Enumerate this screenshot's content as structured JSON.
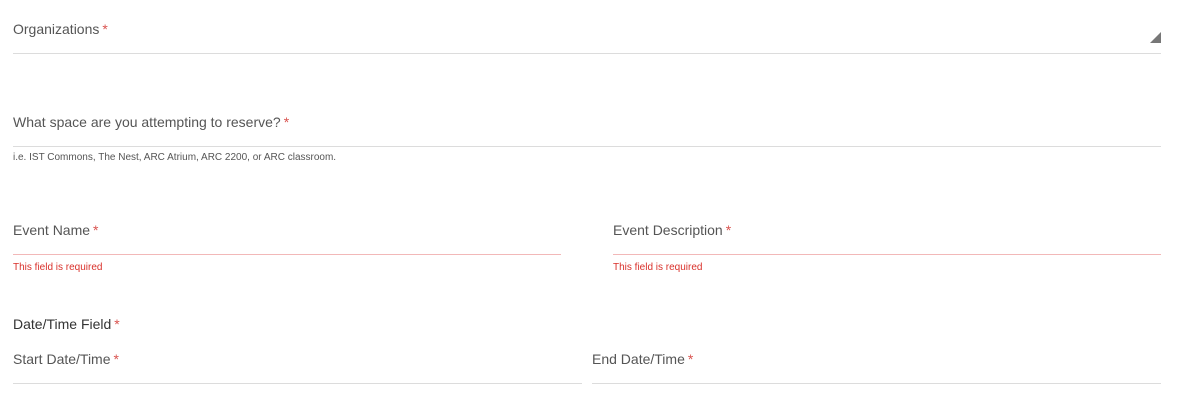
{
  "form": {
    "required_marker": "*",
    "organizations": {
      "label": "Organizations"
    },
    "space": {
      "label": "What space are you attempting to reserve?",
      "hint": "i.e. IST Commons, The Nest, ARC Atrium, ARC 2200, or ARC classroom."
    },
    "event_name": {
      "label": "Event Name",
      "error": "This field is required"
    },
    "event_description": {
      "label": "Event Description",
      "error": "This field is required"
    },
    "datetime": {
      "label": "Date/Time Field",
      "start_label": "Start Date/Time",
      "end_label": "End Date/Time"
    }
  },
  "colors": {
    "required": "#d9534f",
    "error": "#d9302a",
    "underline": "#dcdcdc",
    "error_underline": "#f2b8b8"
  },
  "icons": {
    "select_caret": "triangle-down-right-icon"
  }
}
